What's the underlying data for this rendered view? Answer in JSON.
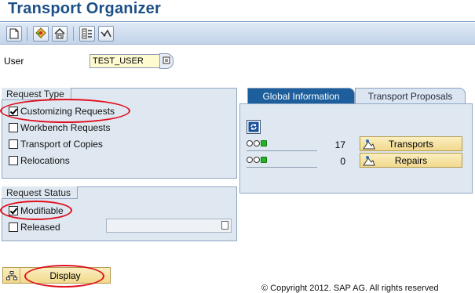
{
  "window": {
    "title": "Transport Organizer"
  },
  "toolbar": {
    "buttons": [
      {
        "name": "new-document"
      },
      {
        "name": "transport-objects"
      },
      {
        "name": "transport-tree"
      },
      {
        "name": "settings"
      },
      {
        "name": "display-options"
      }
    ]
  },
  "user": {
    "label": "User",
    "value": "TEST_USER"
  },
  "request_type": {
    "title": "Request Type",
    "options": [
      {
        "label": "Customizing Requests",
        "checked": true
      },
      {
        "label": "Workbench Requests",
        "checked": false
      },
      {
        "label": "Transport of Copies",
        "checked": false
      },
      {
        "label": "Relocations",
        "checked": false
      }
    ]
  },
  "request_status": {
    "title": "Request Status",
    "options": [
      {
        "label": "Modifiable",
        "checked": true
      },
      {
        "label": "Released",
        "checked": false
      }
    ],
    "released_value": ""
  },
  "tabs": {
    "global": "Global Information",
    "proposals": "Transport Proposals"
  },
  "global_info": {
    "rows": [
      {
        "count": "17",
        "button": "Transports"
      },
      {
        "count": "0",
        "button": "Repairs"
      }
    ]
  },
  "actions": {
    "display": "Display"
  },
  "footer": {
    "copyright": "© Copyright 2012. SAP AG. All rights reserved"
  },
  "colors": {
    "title": "#1b4f86",
    "active_tab": "#1d5e9c",
    "highlight_ring": "#e0101e",
    "button": "#f1d98c"
  }
}
